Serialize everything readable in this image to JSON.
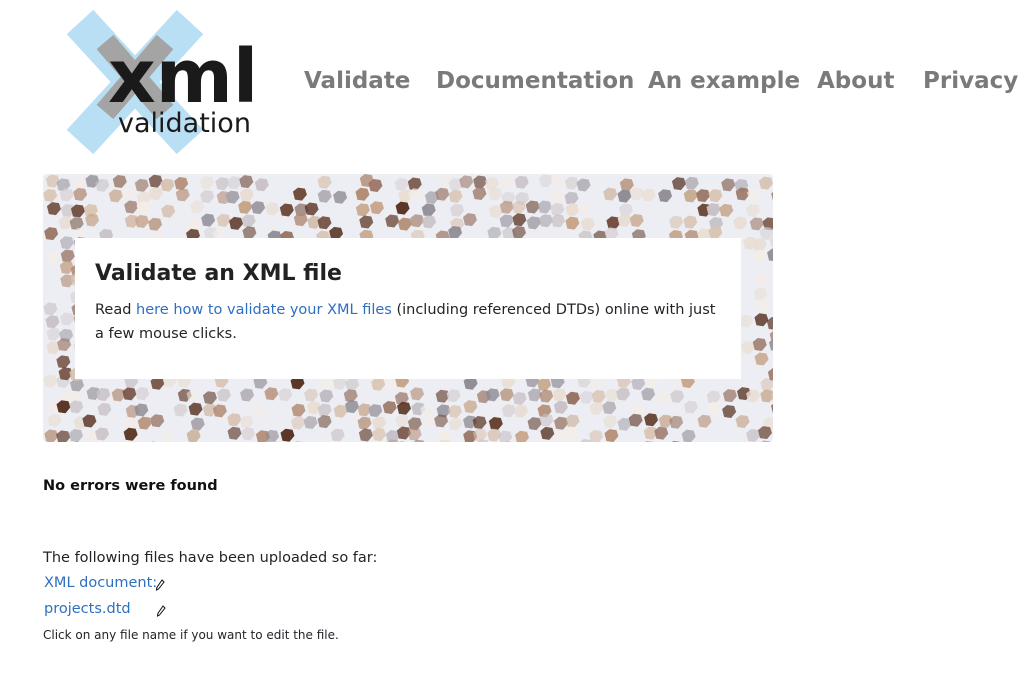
{
  "logo": {
    "word": "xml",
    "sub": "validation"
  },
  "nav": [
    {
      "label": "Validate"
    },
    {
      "label": "Documentation"
    },
    {
      "label": "An example"
    },
    {
      "label": "About"
    },
    {
      "label": "Privacy"
    }
  ],
  "hero": {
    "title": "Validate an XML file",
    "text_before": "Read ",
    "link": "here how to validate your XML files",
    "text_after": " (including referenced DTDs) online with just a few mouse clicks."
  },
  "status": "No errors were found",
  "uploaded": {
    "heading": "The following files have been uploaded so far:",
    "files": [
      {
        "name": "XML document:",
        "icon": "pencil-icon"
      },
      {
        "name": "projects.dtd",
        "icon": "pencil-icon"
      }
    ],
    "hint": "Click on any file name if you want to edit the file."
  },
  "colors": {
    "link": "#2f6fbf",
    "nav": "#7a7a7a",
    "logo_x": "#b9dff5",
    "logo_gray": "#a0a0a0"
  }
}
